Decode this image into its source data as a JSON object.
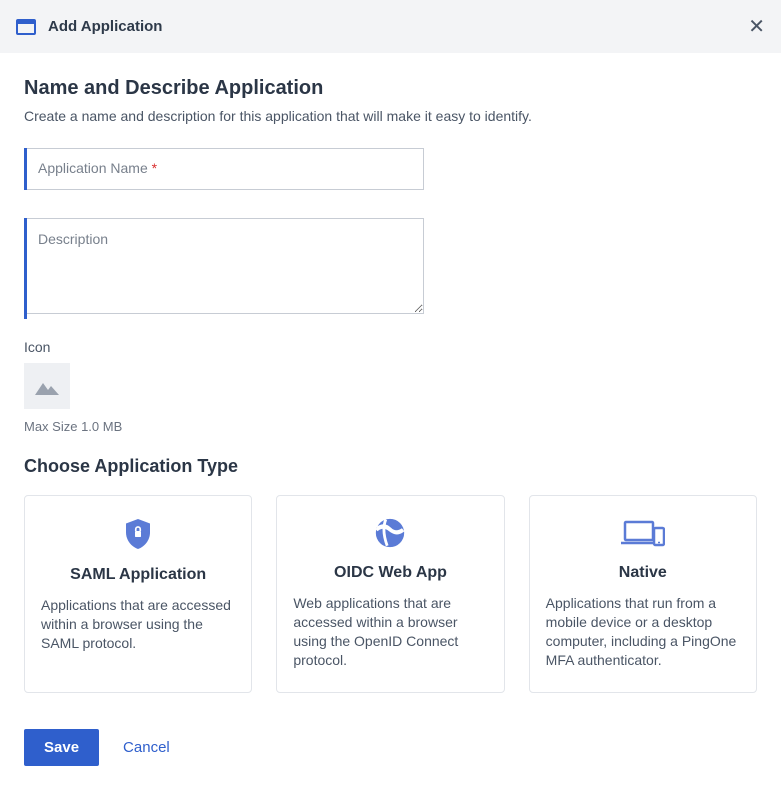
{
  "header": {
    "title": "Add Application"
  },
  "section1": {
    "heading": "Name and Describe Application",
    "subtext": "Create a name and description for this application that will make it easy to identify."
  },
  "fields": {
    "name_placeholder": "Application Name",
    "name_value": "",
    "required_mark": "*",
    "description_placeholder": "Description",
    "description_value": "",
    "icon_label": "Icon",
    "icon_hint": "Max Size 1.0 MB"
  },
  "section2": {
    "heading": "Choose Application Type"
  },
  "types": [
    {
      "icon": "shield",
      "title": "SAML Application",
      "desc": "Applications that are accessed within a browser using the SAML protocol."
    },
    {
      "icon": "globe",
      "title": "OIDC Web App",
      "desc": "Web applications that are accessed within a browser using the OpenID Connect protocol."
    },
    {
      "icon": "devices",
      "title": "Native",
      "desc": "Applications that run from a mobile device or a desktop computer, including a PingOne MFA authenticator."
    }
  ],
  "actions": {
    "save": "Save",
    "cancel": "Cancel"
  }
}
